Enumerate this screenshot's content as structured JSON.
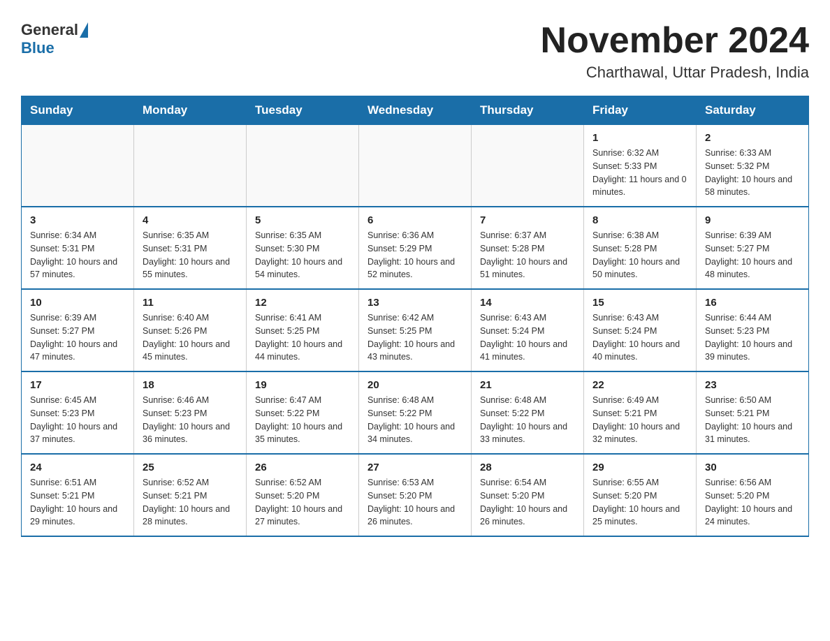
{
  "header": {
    "logo_general": "General",
    "logo_blue": "Blue",
    "month_title": "November 2024",
    "location": "Charthawal, Uttar Pradesh, India"
  },
  "calendar": {
    "days_of_week": [
      "Sunday",
      "Monday",
      "Tuesday",
      "Wednesday",
      "Thursday",
      "Friday",
      "Saturday"
    ],
    "weeks": [
      [
        {
          "day": "",
          "info": ""
        },
        {
          "day": "",
          "info": ""
        },
        {
          "day": "",
          "info": ""
        },
        {
          "day": "",
          "info": ""
        },
        {
          "day": "",
          "info": ""
        },
        {
          "day": "1",
          "info": "Sunrise: 6:32 AM\nSunset: 5:33 PM\nDaylight: 11 hours and 0 minutes."
        },
        {
          "day": "2",
          "info": "Sunrise: 6:33 AM\nSunset: 5:32 PM\nDaylight: 10 hours and 58 minutes."
        }
      ],
      [
        {
          "day": "3",
          "info": "Sunrise: 6:34 AM\nSunset: 5:31 PM\nDaylight: 10 hours and 57 minutes."
        },
        {
          "day": "4",
          "info": "Sunrise: 6:35 AM\nSunset: 5:31 PM\nDaylight: 10 hours and 55 minutes."
        },
        {
          "day": "5",
          "info": "Sunrise: 6:35 AM\nSunset: 5:30 PM\nDaylight: 10 hours and 54 minutes."
        },
        {
          "day": "6",
          "info": "Sunrise: 6:36 AM\nSunset: 5:29 PM\nDaylight: 10 hours and 52 minutes."
        },
        {
          "day": "7",
          "info": "Sunrise: 6:37 AM\nSunset: 5:28 PM\nDaylight: 10 hours and 51 minutes."
        },
        {
          "day": "8",
          "info": "Sunrise: 6:38 AM\nSunset: 5:28 PM\nDaylight: 10 hours and 50 minutes."
        },
        {
          "day": "9",
          "info": "Sunrise: 6:39 AM\nSunset: 5:27 PM\nDaylight: 10 hours and 48 minutes."
        }
      ],
      [
        {
          "day": "10",
          "info": "Sunrise: 6:39 AM\nSunset: 5:27 PM\nDaylight: 10 hours and 47 minutes."
        },
        {
          "day": "11",
          "info": "Sunrise: 6:40 AM\nSunset: 5:26 PM\nDaylight: 10 hours and 45 minutes."
        },
        {
          "day": "12",
          "info": "Sunrise: 6:41 AM\nSunset: 5:25 PM\nDaylight: 10 hours and 44 minutes."
        },
        {
          "day": "13",
          "info": "Sunrise: 6:42 AM\nSunset: 5:25 PM\nDaylight: 10 hours and 43 minutes."
        },
        {
          "day": "14",
          "info": "Sunrise: 6:43 AM\nSunset: 5:24 PM\nDaylight: 10 hours and 41 minutes."
        },
        {
          "day": "15",
          "info": "Sunrise: 6:43 AM\nSunset: 5:24 PM\nDaylight: 10 hours and 40 minutes."
        },
        {
          "day": "16",
          "info": "Sunrise: 6:44 AM\nSunset: 5:23 PM\nDaylight: 10 hours and 39 minutes."
        }
      ],
      [
        {
          "day": "17",
          "info": "Sunrise: 6:45 AM\nSunset: 5:23 PM\nDaylight: 10 hours and 37 minutes."
        },
        {
          "day": "18",
          "info": "Sunrise: 6:46 AM\nSunset: 5:23 PM\nDaylight: 10 hours and 36 minutes."
        },
        {
          "day": "19",
          "info": "Sunrise: 6:47 AM\nSunset: 5:22 PM\nDaylight: 10 hours and 35 minutes."
        },
        {
          "day": "20",
          "info": "Sunrise: 6:48 AM\nSunset: 5:22 PM\nDaylight: 10 hours and 34 minutes."
        },
        {
          "day": "21",
          "info": "Sunrise: 6:48 AM\nSunset: 5:22 PM\nDaylight: 10 hours and 33 minutes."
        },
        {
          "day": "22",
          "info": "Sunrise: 6:49 AM\nSunset: 5:21 PM\nDaylight: 10 hours and 32 minutes."
        },
        {
          "day": "23",
          "info": "Sunrise: 6:50 AM\nSunset: 5:21 PM\nDaylight: 10 hours and 31 minutes."
        }
      ],
      [
        {
          "day": "24",
          "info": "Sunrise: 6:51 AM\nSunset: 5:21 PM\nDaylight: 10 hours and 29 minutes."
        },
        {
          "day": "25",
          "info": "Sunrise: 6:52 AM\nSunset: 5:21 PM\nDaylight: 10 hours and 28 minutes."
        },
        {
          "day": "26",
          "info": "Sunrise: 6:52 AM\nSunset: 5:20 PM\nDaylight: 10 hours and 27 minutes."
        },
        {
          "day": "27",
          "info": "Sunrise: 6:53 AM\nSunset: 5:20 PM\nDaylight: 10 hours and 26 minutes."
        },
        {
          "day": "28",
          "info": "Sunrise: 6:54 AM\nSunset: 5:20 PM\nDaylight: 10 hours and 26 minutes."
        },
        {
          "day": "29",
          "info": "Sunrise: 6:55 AM\nSunset: 5:20 PM\nDaylight: 10 hours and 25 minutes."
        },
        {
          "day": "30",
          "info": "Sunrise: 6:56 AM\nSunset: 5:20 PM\nDaylight: 10 hours and 24 minutes."
        }
      ]
    ]
  }
}
